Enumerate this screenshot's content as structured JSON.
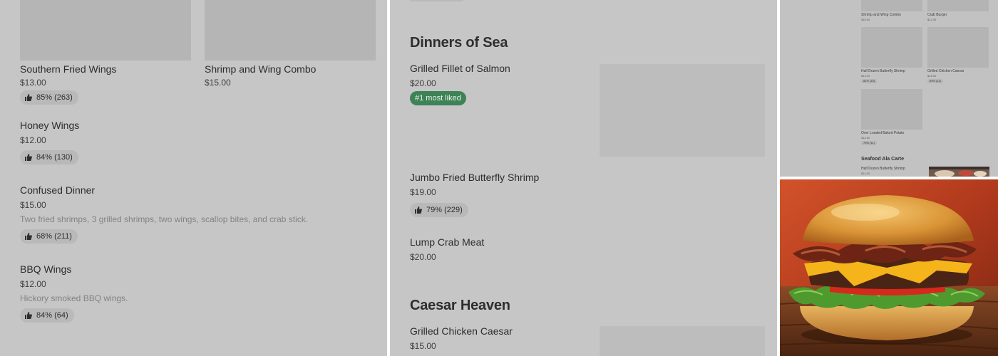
{
  "left_panel": {
    "top_thumbs": [
      "thumb-a",
      "thumb-b"
    ],
    "items": [
      {
        "name": "Southern Fried Wings",
        "price": "$13.00",
        "rating": "85% (263)"
      },
      {
        "name": "Shrimp and Wing Combo",
        "price": "$15.00"
      },
      {
        "name": "Honey Wings",
        "price": "$12.00",
        "rating": "84% (130)"
      },
      {
        "name": "Confused Dinner",
        "price": "$15.00",
        "description": "Two fried shrimps, 3 grilled shrimps, two wings, scallop bites, and crab stick.",
        "rating": "68% (211)"
      },
      {
        "name": "BBQ Wings",
        "price": "$12.00",
        "description": "Hickory smoked BBQ wings.",
        "rating": "84% (64)"
      }
    ]
  },
  "middle_panel": {
    "sections": [
      {
        "title": "Dinners of Sea",
        "items": [
          {
            "name": "Grilled Fillet of Salmon",
            "price": "$20.00",
            "badge": "#1 most liked"
          },
          {
            "name": "Jumbo Fried Butterfly Shrimp",
            "price": "$19.00",
            "rating": "79% (229)"
          },
          {
            "name": "Lump Crab Meat",
            "price": "$20.00"
          }
        ]
      },
      {
        "title": "Caesar Heaven",
        "items": [
          {
            "name": "Grilled Chicken Caesar",
            "price": "$15.00"
          }
        ]
      }
    ]
  },
  "mini_panel": {
    "items": [
      {
        "name": "Shrimp and Wing Combo",
        "price": "$15.00"
      },
      {
        "name": "Crab Burger",
        "price": "$12.00"
      },
      {
        "name": "Half Dozen Butterfly Shrimp",
        "price": "$14.00",
        "rating": "81% (15)"
      },
      {
        "name": "Grilled Chicken Caesar",
        "price": "$15.00",
        "rating": "69% (11)"
      },
      {
        "name": "Over Loaded Baked Potato",
        "price": "$14.00",
        "rating": "79% (11)"
      }
    ],
    "section_title": "Seafood Ala Carte",
    "section_item": {
      "name": "Half Dozen Butterfly Shrimp",
      "price": "$14.00"
    }
  },
  "photo": {
    "icon": "cheeseburger-photo"
  },
  "colors": {
    "badge_green": "#3e8257",
    "panel_gray": "#c6c6c6"
  }
}
